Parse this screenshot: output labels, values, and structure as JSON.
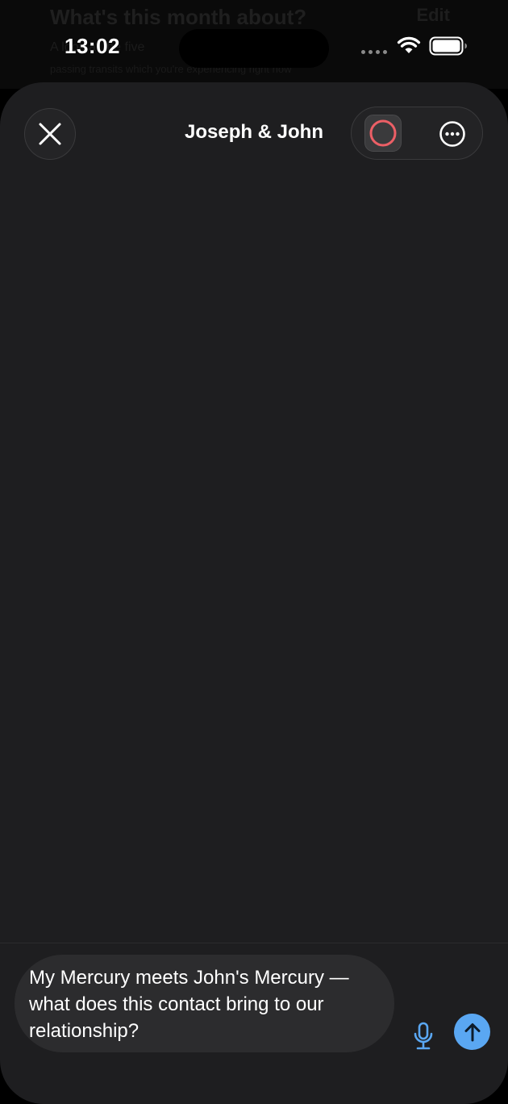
{
  "background_page": {
    "title": "What's this month about?",
    "action": "Edit",
    "subtitle": "A look at the five",
    "subtitle_2": "passing transits which you're experiencing right now"
  },
  "status_bar": {
    "time": "13:02"
  },
  "sheet": {
    "title": "Joseph & John",
    "close_icon": "close-icon",
    "record_icon": "record-icon",
    "more_icon": "more-icon"
  },
  "composer": {
    "text": "My Mercury meets John's Mercury — what does this contact bring to our relationship?",
    "mic_icon": "microphone-icon",
    "send_icon": "arrow-up-icon"
  },
  "colors": {
    "accent": "#5aa7f2",
    "record": "#ec5f66",
    "sheet_background": "#1e1e20"
  }
}
